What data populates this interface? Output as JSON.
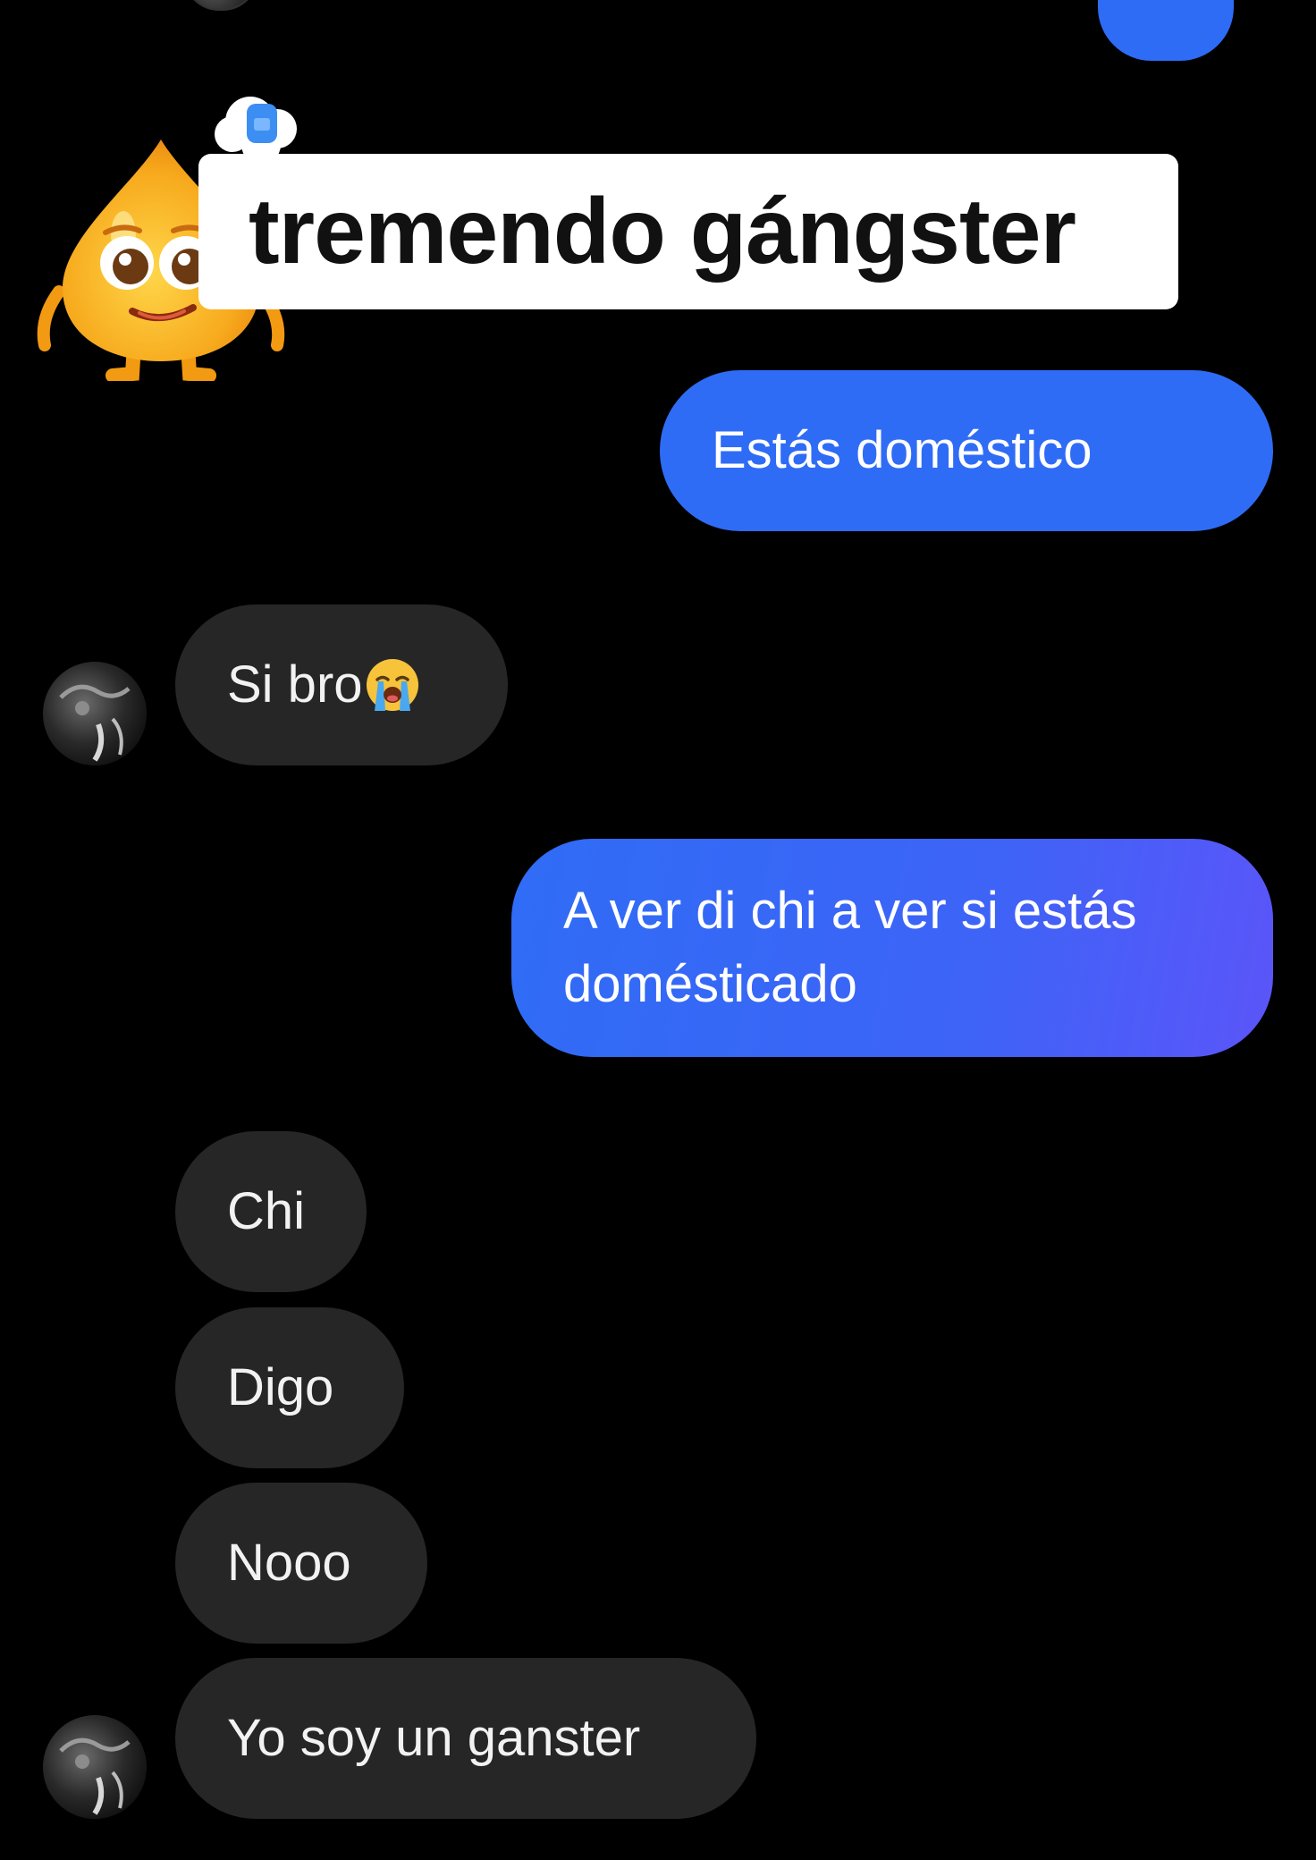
{
  "caption": {
    "text": "tremendo gángster"
  },
  "messages": {
    "out_1": "Estás doméstico",
    "in_1_text": "Si bro",
    "in_1_emoji": "loudly-crying-face-icon",
    "out_2": "A ver di chi a ver si estás domésticado",
    "in_2": "Chi",
    "in_3": "Digo",
    "in_4": "Nooo",
    "in_5": "Yo soy un ganster"
  },
  "colors": {
    "background": "#000000",
    "outgoing_bubble": "#2f6cf6",
    "incoming_bubble": "#262626",
    "caption_bg": "#ffffff"
  }
}
